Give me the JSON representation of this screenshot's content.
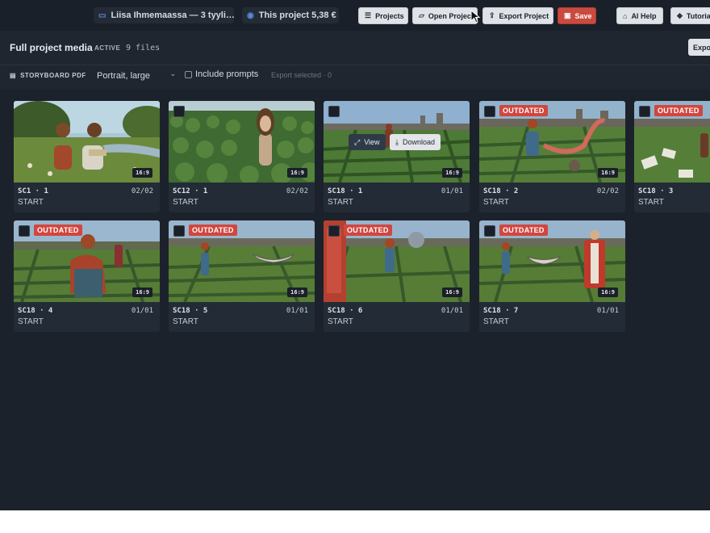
{
  "header": {
    "project_pill": "Liisa Ihmemaassa — 3 tyyli…",
    "cost_pill": "This project 5,38 €",
    "buttons": {
      "projects": "Projects",
      "open_project": "Open Project",
      "export_project": "Export Project",
      "save": "Save",
      "ai_help": "AI Help",
      "tutorial": "Tutorial"
    }
  },
  "media": {
    "title": "Full project media",
    "status": "ACTIVE",
    "file_count": "9 files",
    "export_button": "Export"
  },
  "toolbar": {
    "storyboard_label": "STORYBOARD PDF",
    "layout_select": "Portrait, large",
    "include_prompts": "Include prompts",
    "export_selected": "Export selected · 0"
  },
  "hover": {
    "view": "View",
    "download": "Download"
  },
  "cards": [
    {
      "scene": "SC1 · 1",
      "frac": "02/02",
      "status": "START",
      "ratio": "16:9",
      "badge": ""
    },
    {
      "scene": "SC12 · 1",
      "frac": "02/02",
      "status": "START",
      "ratio": "16:9",
      "badge": ""
    },
    {
      "scene": "SC18 · 1",
      "frac": "01/01",
      "status": "START",
      "ratio": "16:9",
      "badge": ""
    },
    {
      "scene": "SC18 · 2",
      "frac": "02/02",
      "status": "START",
      "ratio": "16:9",
      "badge": "OUTDATED"
    },
    {
      "scene": "SC18 · 3",
      "frac": "",
      "status": "START",
      "ratio": "",
      "badge": "OUTDATED"
    },
    {
      "scene": "SC18 · 4",
      "frac": "01/01",
      "status": "START",
      "ratio": "16:9",
      "badge": "OUTDATED"
    },
    {
      "scene": "SC18 · 5",
      "frac": "01/01",
      "status": "START",
      "ratio": "16:9",
      "badge": "OUTDATED"
    },
    {
      "scene": "SC18 · 6",
      "frac": "01/01",
      "status": "START",
      "ratio": "16:9",
      "badge": "OUTDATED"
    },
    {
      "scene": "SC18 · 7",
      "frac": "01/01",
      "status": "START",
      "ratio": "16:9",
      "badge": "OUTDATED"
    }
  ],
  "colors": {
    "accent": "#5b8bd6",
    "outdated": "#d1463f",
    "save": "#c94a3f"
  }
}
